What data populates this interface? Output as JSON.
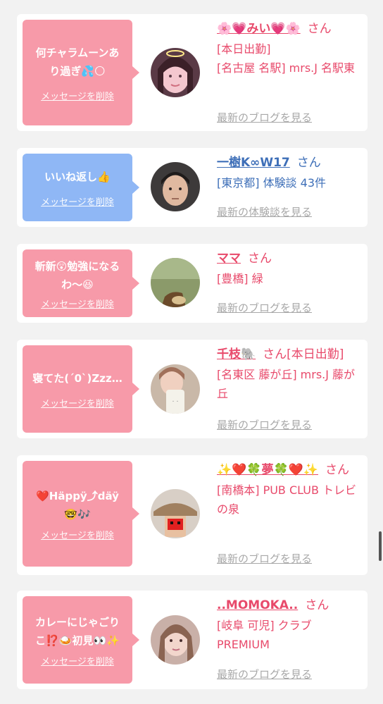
{
  "delete_label": "メッセージを削除",
  "colors": {
    "pink": "#f79aa9",
    "blue": "#8fb7f5",
    "name_pink": "#e84a6b",
    "name_blue": "#3e6fb8",
    "link_gray": "#a8a8a8"
  },
  "cards": [
    {
      "bubble_color": "pink",
      "message": "何チャラムーンあ\nり過ぎ💦🌕",
      "avatar_icon": "avatar-photo-1",
      "name": "🌸💗みい💗🌸",
      "san": "さん",
      "detail": "[本日出勤]\n[名古屋 名駅] mrs.J 名駅東",
      "link": "最新のブログを見る"
    },
    {
      "bubble_color": "blue",
      "message": "いいね返し👍",
      "avatar_icon": "avatar-photo-2",
      "name": "一樹K∞W17",
      "san": "さん",
      "detail": "[東京都] 体験談 43件",
      "link": "最新の体験談を見る"
    },
    {
      "bubble_color": "pink",
      "message": "斬新😲勉強になる\nわ〜😆",
      "avatar_icon": "avatar-photo-3",
      "name": "ママ",
      "san": "さん",
      "detail": "[豊橋] 緑",
      "link": "最新のブログを見る"
    },
    {
      "bubble_color": "pink",
      "message": "寝てた(´0`)Zzz…",
      "avatar_icon": "avatar-photo-4",
      "name": "千枝🐘",
      "san": "さん[本日出勤]",
      "detail": "[名東区 藤が丘] mrs.J 藤が丘",
      "link": "最新のブログを見る"
    },
    {
      "bubble_color": "pink",
      "message": "❤️Häppÿ⤴︎däÿ\n🤓🎶",
      "avatar_icon": "avatar-photo-5",
      "name": "✨❤️🍀夢🍀❤️✨",
      "san": "さん",
      "detail": "[南橋本] PUB CLUB トレビの泉",
      "link": "最新のブログを見る"
    },
    {
      "bubble_color": "pink",
      "message": "カレーにじゃごり\nこ⁉️🍛初見👀✨",
      "avatar_icon": "avatar-photo-6",
      "name": "..MOMOKA..",
      "san": "さん",
      "detail": "[岐阜 可児] クラブ PREMIUM",
      "link": "最新のブログを見る"
    }
  ]
}
